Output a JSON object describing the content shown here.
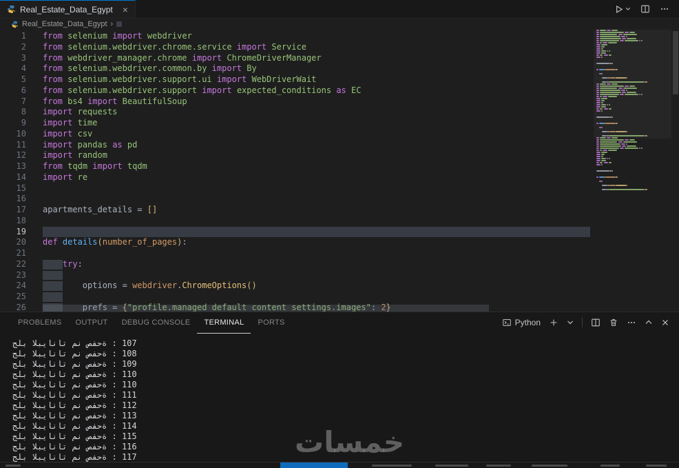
{
  "tab_bar": {
    "tab": {
      "label": "Real_Estate_Data_Egypt",
      "close": "×"
    }
  },
  "breadcrumb": {
    "file": "Real_Estate_Data_Egypt",
    "separator": "›"
  },
  "editor": {
    "colors": {
      "k": "#c678dd",
      "m": "#98c379",
      "d": "#abb2bf",
      "f": "#61afef",
      "p": "#d19a66",
      "b": "#d7ba7d",
      "y": "#e5c07b",
      "s": "#98c379",
      "c": "#d19a66"
    },
    "lines": [
      {
        "n": 1,
        "t": [
          [
            "k",
            "from"
          ],
          [
            "d",
            " "
          ],
          [
            "m",
            "selenium"
          ],
          [
            "d",
            " "
          ],
          [
            "k",
            "import"
          ],
          [
            "d",
            " "
          ],
          [
            "m",
            "webdriver"
          ]
        ]
      },
      {
        "n": 2,
        "t": [
          [
            "k",
            "from"
          ],
          [
            "d",
            " "
          ],
          [
            "m",
            "selenium.webdriver.chrome.service"
          ],
          [
            "d",
            " "
          ],
          [
            "k",
            "import"
          ],
          [
            "d",
            " "
          ],
          [
            "m",
            "Service"
          ]
        ]
      },
      {
        "n": 3,
        "t": [
          [
            "k",
            "from"
          ],
          [
            "d",
            " "
          ],
          [
            "m",
            "webdriver_manager.chrome"
          ],
          [
            "d",
            " "
          ],
          [
            "k",
            "import"
          ],
          [
            "d",
            " "
          ],
          [
            "m",
            "ChromeDriverManager"
          ]
        ]
      },
      {
        "n": 4,
        "t": [
          [
            "k",
            "from"
          ],
          [
            "d",
            " "
          ],
          [
            "m",
            "selenium.webdriver.common.by"
          ],
          [
            "d",
            " "
          ],
          [
            "k",
            "import"
          ],
          [
            "d",
            " "
          ],
          [
            "m",
            "By"
          ]
        ]
      },
      {
        "n": 5,
        "t": [
          [
            "k",
            "from"
          ],
          [
            "d",
            " "
          ],
          [
            "m",
            "selenium.webdriver.support.ui"
          ],
          [
            "d",
            " "
          ],
          [
            "k",
            "import"
          ],
          [
            "d",
            " "
          ],
          [
            "m",
            "WebDriverWait"
          ]
        ]
      },
      {
        "n": 6,
        "t": [
          [
            "k",
            "from"
          ],
          [
            "d",
            " "
          ],
          [
            "m",
            "selenium.webdriver.support"
          ],
          [
            "d",
            " "
          ],
          [
            "k",
            "import"
          ],
          [
            "d",
            " "
          ],
          [
            "m",
            "expected_conditions"
          ],
          [
            "d",
            " "
          ],
          [
            "k",
            "as"
          ],
          [
            "d",
            " "
          ],
          [
            "m",
            "EC"
          ]
        ]
      },
      {
        "n": 7,
        "t": [
          [
            "k",
            "from"
          ],
          [
            "d",
            " "
          ],
          [
            "m",
            "bs4"
          ],
          [
            "d",
            " "
          ],
          [
            "k",
            "import"
          ],
          [
            "d",
            " "
          ],
          [
            "m",
            "BeautifulSoup"
          ]
        ]
      },
      {
        "n": 8,
        "t": [
          [
            "k",
            "import"
          ],
          [
            "d",
            " "
          ],
          [
            "m",
            "requests"
          ]
        ]
      },
      {
        "n": 9,
        "t": [
          [
            "k",
            "import"
          ],
          [
            "d",
            " "
          ],
          [
            "m",
            "time"
          ]
        ]
      },
      {
        "n": 10,
        "t": [
          [
            "k",
            "import"
          ],
          [
            "d",
            " "
          ],
          [
            "m",
            "csv"
          ]
        ]
      },
      {
        "n": 11,
        "t": [
          [
            "k",
            "import"
          ],
          [
            "d",
            " "
          ],
          [
            "m",
            "pandas"
          ],
          [
            "d",
            " "
          ],
          [
            "k",
            "as"
          ],
          [
            "d",
            " "
          ],
          [
            "m",
            "pd"
          ]
        ]
      },
      {
        "n": 12,
        "t": [
          [
            "k",
            "import"
          ],
          [
            "d",
            " "
          ],
          [
            "m",
            "random"
          ]
        ]
      },
      {
        "n": 13,
        "t": [
          [
            "k",
            "from"
          ],
          [
            "d",
            " "
          ],
          [
            "m",
            "tqdm"
          ],
          [
            "d",
            " "
          ],
          [
            "k",
            "import"
          ],
          [
            "d",
            " "
          ],
          [
            "m",
            "tqdm"
          ]
        ]
      },
      {
        "n": 14,
        "t": [
          [
            "k",
            "import"
          ],
          [
            "d",
            " "
          ],
          [
            "m",
            "re"
          ]
        ]
      },
      {
        "n": 15,
        "t": []
      },
      {
        "n": 16,
        "t": []
      },
      {
        "n": 17,
        "t": [
          [
            "d",
            "apartments_details"
          ],
          [
            "d",
            " = "
          ],
          [
            "b",
            "[]"
          ]
        ]
      },
      {
        "n": 18,
        "t": []
      },
      {
        "n": 19,
        "t": [],
        "bar": true,
        "cur": true
      },
      {
        "n": 20,
        "t": [
          [
            "k",
            "def"
          ],
          [
            "d",
            " "
          ],
          [
            "f",
            "details"
          ],
          [
            "b",
            "("
          ],
          [
            "p",
            "number_of_pages"
          ],
          [
            "b",
            ")"
          ],
          [
            "d",
            ":"
          ]
        ]
      },
      {
        "n": 21,
        "t": []
      },
      {
        "n": 22,
        "t": [
          [
            "d",
            "    "
          ],
          [
            "k",
            "try"
          ],
          [
            "d",
            ":"
          ]
        ],
        "box": true
      },
      {
        "n": 23,
        "t": [],
        "box": true
      },
      {
        "n": 24,
        "t": [
          [
            "d",
            "        "
          ],
          [
            "d",
            "options"
          ],
          [
            "d",
            " = "
          ],
          [
            "p",
            "webdriver"
          ],
          [
            "d",
            "."
          ],
          [
            "y",
            "ChromeOptions"
          ],
          [
            "b",
            "()"
          ]
        ],
        "box": true
      },
      {
        "n": 25,
        "t": [],
        "box": true
      },
      {
        "n": 26,
        "t": [
          [
            "d",
            "        "
          ],
          [
            "d",
            "prefs"
          ],
          [
            "d",
            " = "
          ],
          [
            "b",
            "{"
          ],
          [
            "s",
            "\"profile.managed_default_content_settings.images\""
          ],
          [
            "d",
            ": "
          ],
          [
            "c",
            "2"
          ],
          [
            "b",
            "}"
          ]
        ],
        "box": true
      }
    ]
  },
  "panel": {
    "tabs": [
      {
        "label": "PROBLEMS",
        "active": false
      },
      {
        "label": "OUTPUT",
        "active": false
      },
      {
        "label": "DEBUG CONSOLE",
        "active": false
      },
      {
        "label": "TERMINAL",
        "active": true
      },
      {
        "label": "PORTS",
        "active": false
      }
    ],
    "shell": {
      "label": "Python"
    },
    "terminal": {
      "prefix": "جلب البيانات من صفحة : ",
      "pages": [
        "107",
        "108",
        "109",
        "110",
        "110",
        "111",
        "112",
        "113",
        "114",
        "115",
        "116",
        "117"
      ]
    }
  },
  "watermark": {
    "text": "خمسات"
  }
}
